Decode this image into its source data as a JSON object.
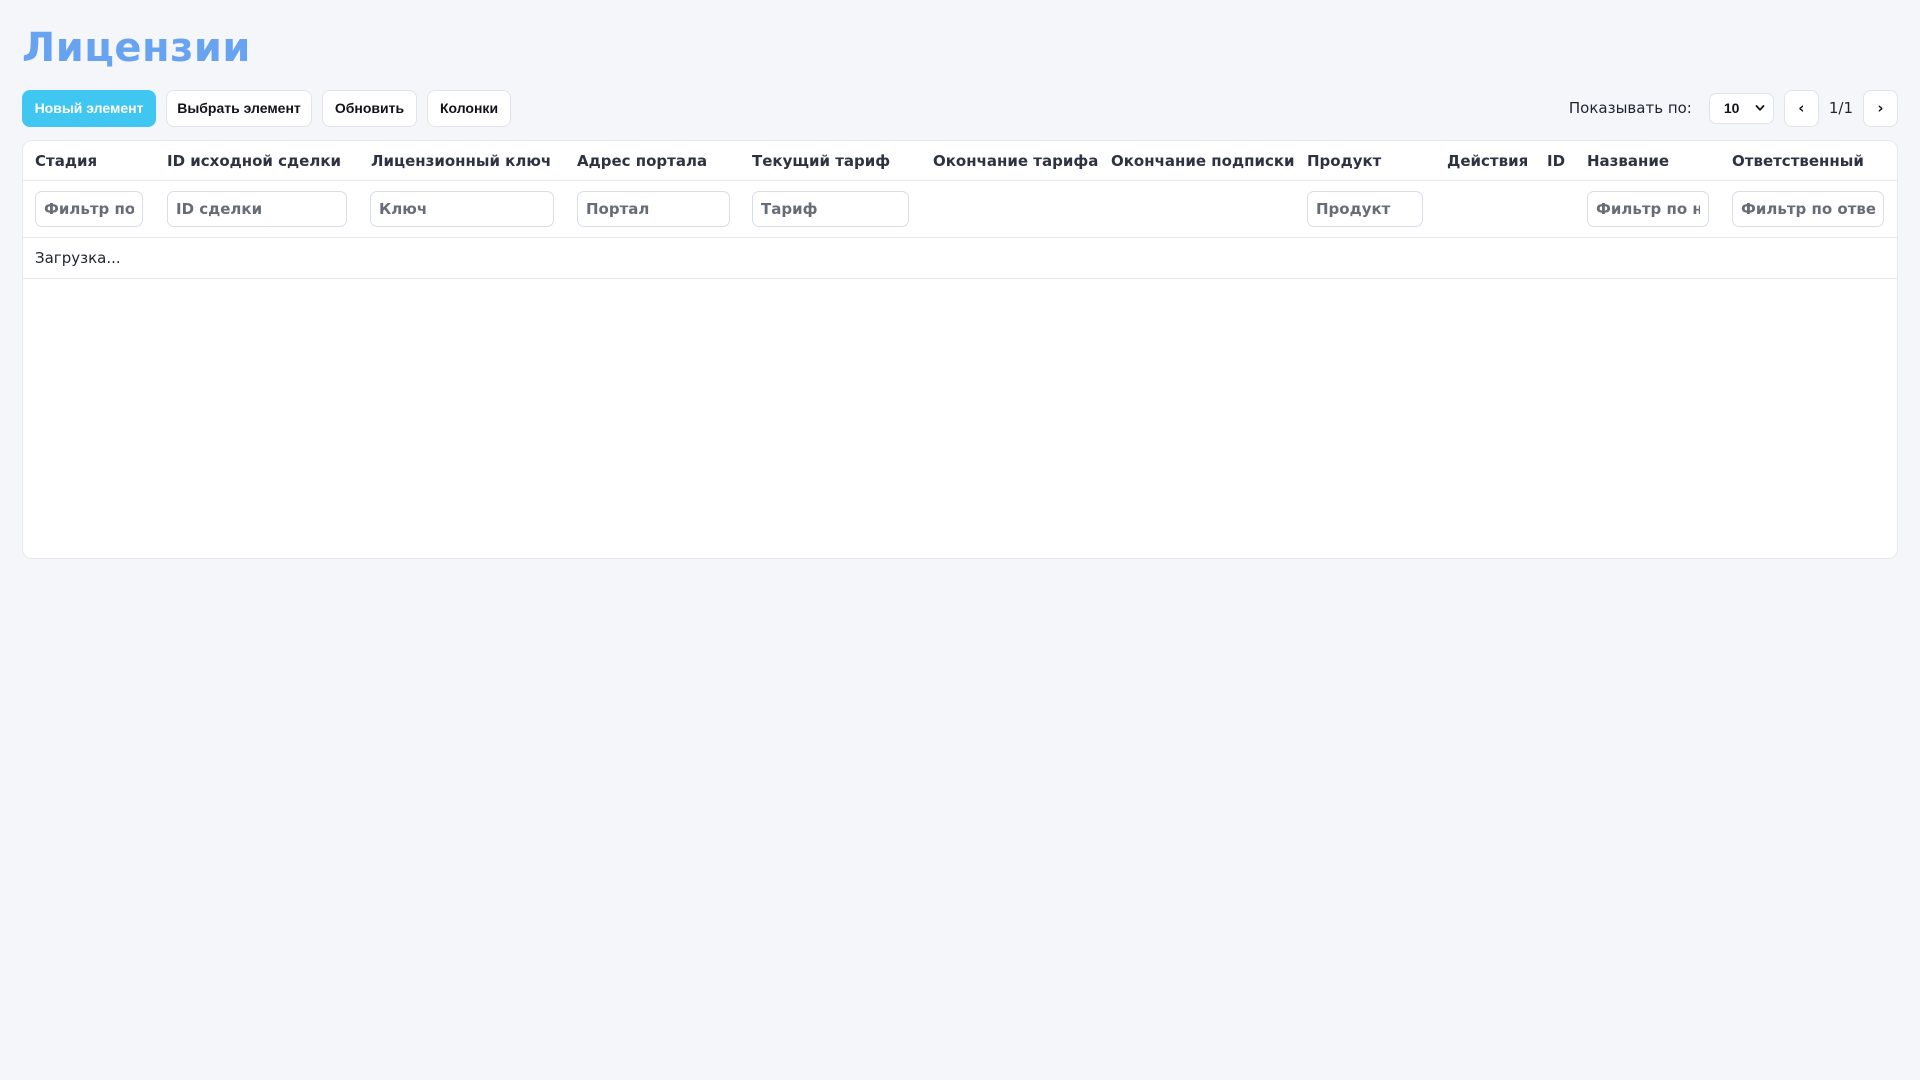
{
  "page": {
    "title": "Лицензии"
  },
  "toolbar": {
    "new_item": "Новый элемент",
    "select_item": "Выбрать элемент",
    "refresh": "Обновить",
    "columns": "Колонки",
    "per_page_label": "Показывать по:",
    "per_page_value": "10",
    "prev": "‹",
    "next": "›",
    "page_indicator": "1/1"
  },
  "table": {
    "columns": [
      "Стадия",
      "ID исходной сделки",
      "Лицензионный ключ",
      "Адрес портала",
      "Текущий тариф",
      "Окончание тарифа",
      "Окончание подписки",
      "Продукт",
      "Действия",
      "ID",
      "Название",
      "Ответственный"
    ],
    "filters": {
      "stage": "Фильтр по",
      "deal_id": "ID сделки",
      "key": "Ключ",
      "portal": "Портал",
      "tariff": "Тариф",
      "product": "Продукт",
      "name": "Фильтр по на",
      "responsible": "Фильтр по ответ"
    },
    "status": "Загрузка..."
  },
  "colors": {
    "accent": "#3fc6f1",
    "title": "#67a3f0",
    "background": "#f5f6fa"
  }
}
